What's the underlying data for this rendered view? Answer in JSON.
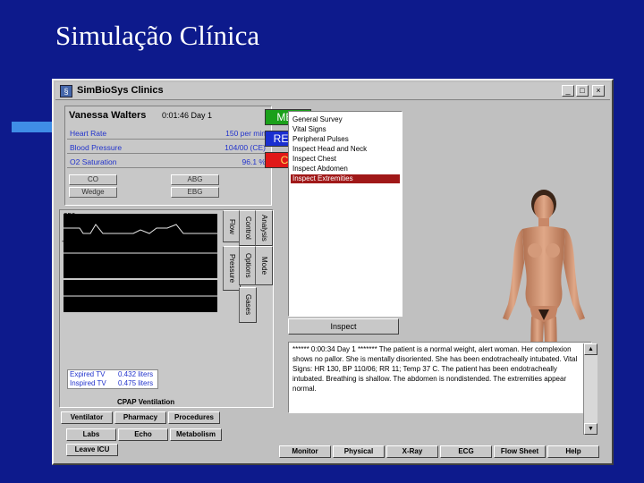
{
  "slide_title": "Simulação Clínica",
  "window": {
    "title": "SimBioSys Clinics",
    "minimize_glyph": "_",
    "maximize_glyph": "□",
    "close_glyph": "×"
  },
  "patient": {
    "name": "Vanessa Walters",
    "clock": "0:01:46 Day 1"
  },
  "vitals": [
    {
      "label": "Heart Rate",
      "value": "150 per min"
    },
    {
      "label": "Blood Pressure",
      "value": "104/00 (CE)"
    },
    {
      "label": "O2 Saturation",
      "value": "96.1 %"
    }
  ],
  "small_buttons": {
    "co": "CO",
    "abg": "ABG",
    "wedge": "Wedge",
    "ebg": "EBG"
  },
  "status_buttons": {
    "met": "MET",
    "resp": "RESP",
    "cv": "CV"
  },
  "graph": {
    "ticks": [
      "250",
      "-250",
      "50",
      "-50"
    ]
  },
  "vertical_tabs": {
    "analysis": "Analysis",
    "mode": "Mode",
    "control": "Control",
    "options": "Options",
    "gases": "Gases",
    "flow": "Flow",
    "pressure": "Pressure"
  },
  "tidal": [
    {
      "label": "Expired TV",
      "value": "0.432 liters"
    },
    {
      "label": "Inspired TV",
      "value": "0.475 liters"
    }
  ],
  "cpap_label": "CPAP Ventilation",
  "left_tabs": {
    "ventilator": "Ventilator",
    "pharmacy": "Pharmacy",
    "procedures": "Procedures",
    "labs": "Labs",
    "echo": "Echo",
    "metabolism": "Metabolism",
    "leave_icu": "Leave ICU"
  },
  "exam_list": [
    "General Survey",
    "Vital Signs",
    "Peripheral Pulses",
    "Inspect Head and Neck",
    "Inspect Chest",
    "Inspect Abdomen",
    "Inspect Extremities"
  ],
  "selected_index": 6,
  "inspect_button": "Inspect",
  "notes": "****** 0:00:34 Day 1 ******* The patient is a normal weight, alert woman. Her complexion shows no pallor. She is mentally disoriented. She has been endotracheally intubated. Vital Signs: HR 130, BP 110/06; RR 11; Temp 37 C. The patient has been endotracheally intubated. Breathing is shallow. The abdomen is nondistended. The extremities appear normal.",
  "bottom_tabs": [
    "Monitor",
    "Physical",
    "X-Ray",
    "ECG",
    "Flow Sheet",
    "Help"
  ]
}
